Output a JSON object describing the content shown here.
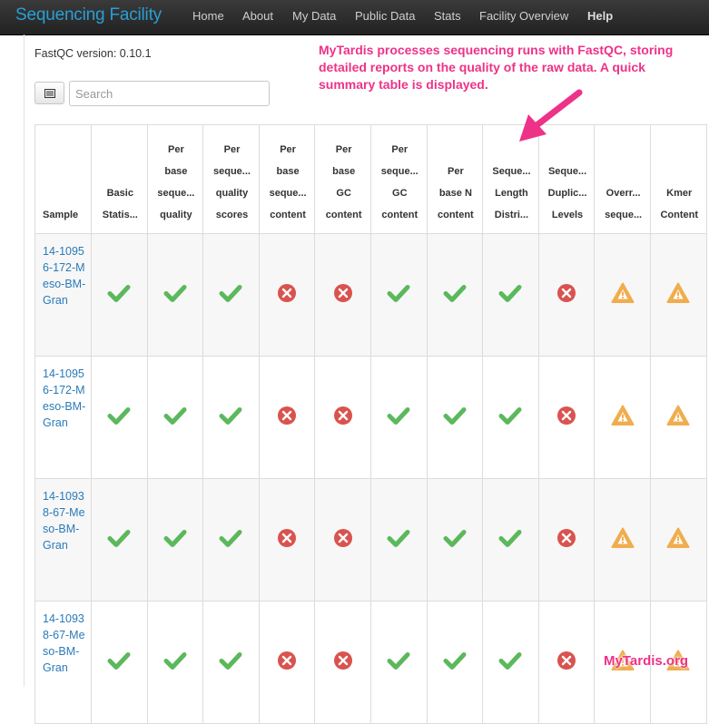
{
  "navbar": {
    "brand": "Sequencing Facility",
    "items": [
      {
        "label": "Home"
      },
      {
        "label": "About"
      },
      {
        "label": "My Data"
      },
      {
        "label": "Public Data"
      },
      {
        "label": "Stats"
      },
      {
        "label": "Facility Overview"
      },
      {
        "label": "Help"
      }
    ]
  },
  "fastqc_version": "FastQC version: 0.10.1",
  "search": {
    "placeholder": "Search",
    "value": ""
  },
  "table": {
    "headers": [
      [
        "Sample"
      ],
      [
        "Basic",
        "Statis..."
      ],
      [
        "Per",
        "base",
        "seque...",
        "quality"
      ],
      [
        "Per",
        "seque...",
        "quality",
        "scores"
      ],
      [
        "Per",
        "base",
        "seque...",
        "content"
      ],
      [
        "Per",
        "base",
        "GC",
        "content"
      ],
      [
        "Per",
        "seque...",
        "GC",
        "content"
      ],
      [
        "Per",
        "base N",
        "content"
      ],
      [
        "Seque...",
        "Length",
        "Distri..."
      ],
      [
        "Seque...",
        "Duplic...",
        "Levels"
      ],
      [
        "Overr...",
        "seque..."
      ],
      [
        "Kmer",
        "Content"
      ]
    ],
    "rows": [
      {
        "sample": "14-10956-172-Meso-BM-Gran",
        "statuses": [
          "pass",
          "pass",
          "pass",
          "fail",
          "fail",
          "pass",
          "pass",
          "pass",
          "fail",
          "warn",
          "warn"
        ]
      },
      {
        "sample": "14-10956-172-Meso-BM-Gran",
        "statuses": [
          "pass",
          "pass",
          "pass",
          "fail",
          "fail",
          "pass",
          "pass",
          "pass",
          "fail",
          "warn",
          "warn"
        ]
      },
      {
        "sample": "14-10938-67-Meso-BM-Gran",
        "statuses": [
          "pass",
          "pass",
          "pass",
          "fail",
          "fail",
          "pass",
          "pass",
          "pass",
          "fail",
          "warn",
          "warn"
        ]
      },
      {
        "sample": "14-10938-67-Meso-BM-Gran",
        "statuses": [
          "pass",
          "pass",
          "pass",
          "fail",
          "fail",
          "pass",
          "pass",
          "pass",
          "fail",
          "warn",
          "warn"
        ]
      }
    ]
  },
  "status_colors": {
    "pass": "#5cb85c",
    "fail": "#d9534f",
    "warn": "#f0ad4e"
  },
  "annotation": "MyTardis processes sequencing runs with FastQC, storing detailed reports on the quality of the raw data. A quick summary table is displayed.",
  "watermark": "MyTardis.org"
}
